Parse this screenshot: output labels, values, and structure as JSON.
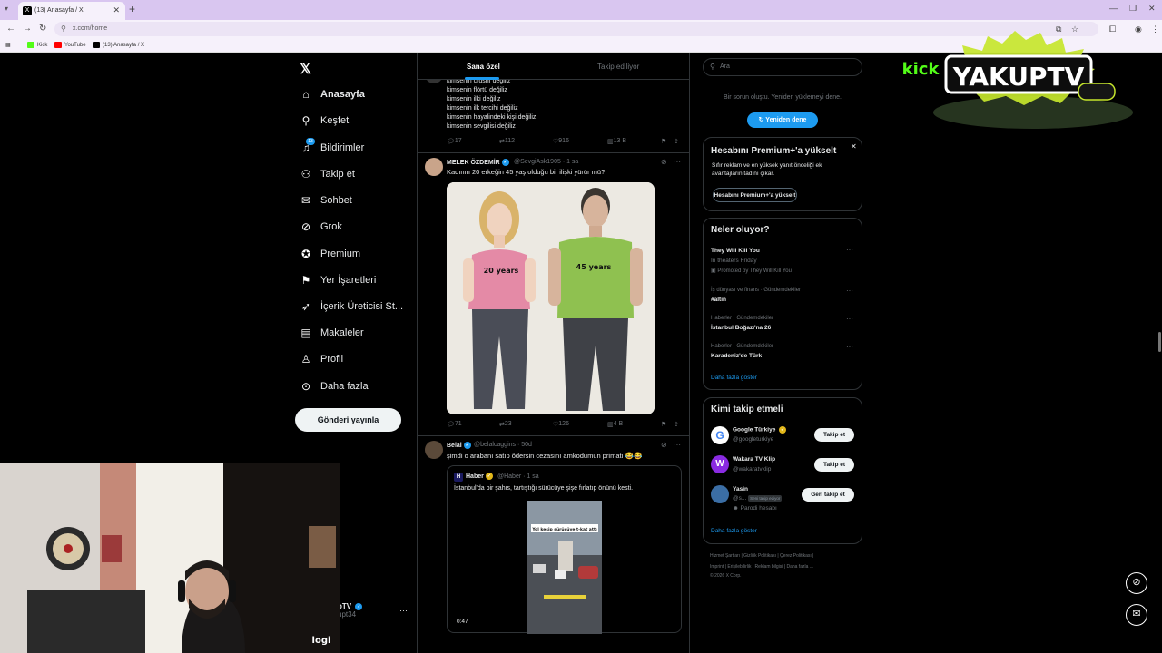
{
  "browser": {
    "tab_title": "(13) Anasayfa / X",
    "new_tab": "+",
    "url": "x.com/home",
    "bookmarks": [
      {
        "label": "Kick",
        "color": "#53fc18"
      },
      {
        "label": "YouTube",
        "color": "#ff0000"
      },
      {
        "label": "(13) Anasayfa / X",
        "color": "#000000"
      }
    ]
  },
  "nav": {
    "items": [
      {
        "label": "Anasayfa",
        "icon": "home-icon"
      },
      {
        "label": "Keşfet",
        "icon": "search-icon"
      },
      {
        "label": "Bildirimler",
        "icon": "bell-icon",
        "badge": "13"
      },
      {
        "label": "Takip et",
        "icon": "add-user-icon"
      },
      {
        "label": "Sohbet",
        "icon": "mail-icon"
      },
      {
        "label": "Grok",
        "icon": "grok-icon"
      },
      {
        "label": "Premium",
        "icon": "premium-icon"
      },
      {
        "label": "Yer İşaretleri",
        "icon": "bookmark-icon"
      },
      {
        "label": "İçerik Üreticisi St...",
        "icon": "rocket-icon"
      },
      {
        "label": "Makaleler",
        "icon": "articles-icon"
      },
      {
        "label": "Profil",
        "icon": "profile-icon"
      },
      {
        "label": "Daha fazla",
        "icon": "more-icon"
      }
    ],
    "post_button": "Gönderi yayınla",
    "account_name": "pTV",
    "account_handle": "upt34"
  },
  "feed": {
    "tabs": [
      "Sana özel",
      "Takip ediliyor"
    ],
    "poem": {
      "lines": [
        "kimsenin crushı değiliz",
        "kimsenin flörtü değiliz",
        "kimsenin ilki değiliz",
        "kimsenin ilk tercihi değiliz",
        "kimsenin hayalindeki kişi değiliz",
        "kimsenin sevgilisi değiliz"
      ],
      "replies": "17",
      "reposts": "112",
      "likes": "916",
      "views": "13 B"
    },
    "tweet1": {
      "name": "MELEK ÖZDEMİR",
      "handle": "@SevgiAsk1905",
      "time": "· 1 sa",
      "text": "Kadının 20 erkeğin 45 yaş olduğu bir ilişki yürür mü?",
      "image_label_left": "20 years",
      "image_label_right": "45 years",
      "replies": "71",
      "reposts": "23",
      "likes": "126",
      "views": "4 B"
    },
    "tweet2": {
      "name": "Belal",
      "handle": "@belalcaggins",
      "time": "· 50d",
      "text": "şimdi o arabanı satıp ödersin cezasını amkodumun primatı 😂😂",
      "quote": {
        "name": "Haber",
        "handle": "@Haber",
        "time": "· 1 sa",
        "text": "İstanbul'da bir şahıs, tartıştığı sürücüye şişe fırlatıp önünü kesti.",
        "video_caption": "Yol kesip sürücüye t-kat attı",
        "video_time": "0:47"
      }
    }
  },
  "right": {
    "search_placeholder": "Ara",
    "error_text": "Bir sorun oluştu. Yeniden yüklemeyi dene.",
    "retry": "Yeniden dene",
    "premium": {
      "title": "Hesabını Premium+'a yükselt",
      "desc1": "Sıfır reklam ve en yüksek yanıt önceliği ek",
      "desc2": "avantajların tadını çıkar.",
      "button": "Hesabını Premium+'a yükselt"
    },
    "trends": {
      "title": "Neler oluyor?",
      "items": [
        {
          "title": "They Will Kill You",
          "sub": "In theaters Friday",
          "sub2": "Promoted by They Will Kill You"
        },
        {
          "context": "İş dünyası ve finans · Gündemdekiler",
          "title": "#altın"
        },
        {
          "context": "Haberler · Gündemdekiler",
          "title": "İstanbul Boğazı'na 26"
        },
        {
          "context": "Haberler · Gündemdekiler",
          "title": "Karadeniz'de Türk"
        }
      ],
      "more": "Daha fazla göster"
    },
    "who_to_follow": {
      "title": "Kimi takip etmeli",
      "users": [
        {
          "name": "Google Türkiye",
          "handle": "@googleturkiye",
          "button": "Takip et"
        },
        {
          "name": "Wakara TV Klip",
          "handle": "@wakaratvklip",
          "button": "Takip et"
        },
        {
          "name": "Yasin",
          "handle": "@s...",
          "badge": "Seni takip ediyor",
          "note": "Parodi hesabı",
          "button": "Geri takip et"
        }
      ],
      "more": "Daha fazla göster"
    },
    "footer": {
      "line1": "Hizmet Şartları | Gizlilik Politikası | Çerez Politikası |",
      "line2": "Imprint | Erişilebilirlik | Reklam bilgisi | Daha fazla ...",
      "line3": "© 2026 X Corp."
    }
  },
  "overlay": {
    "brand_kick": "kick",
    "brand_name": "YAKUPTV",
    "webcam_brand": "logi"
  }
}
